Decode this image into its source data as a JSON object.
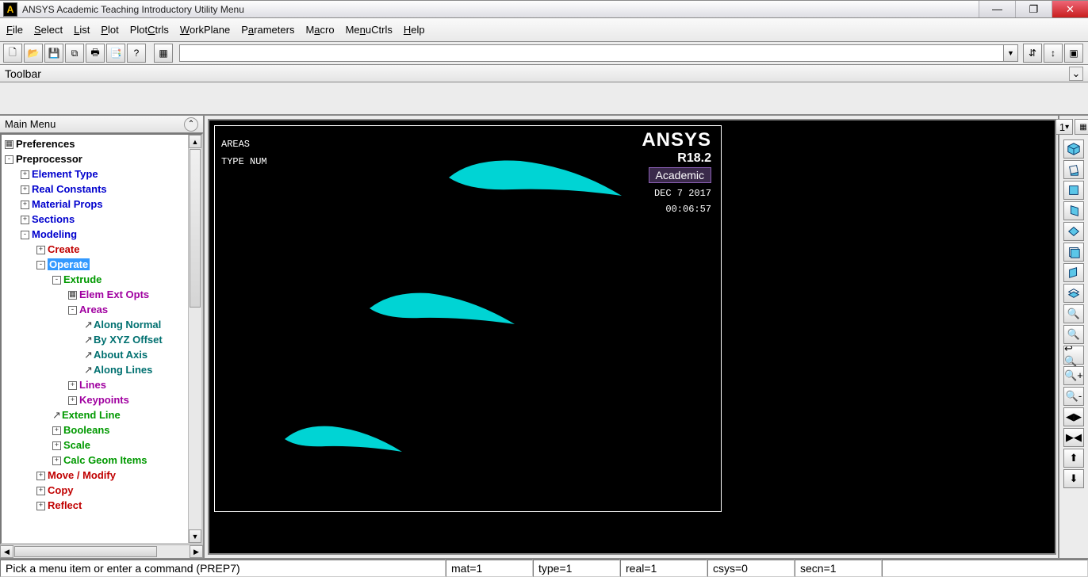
{
  "window": {
    "title": "ANSYS Academic Teaching Introductory Utility Menu"
  },
  "menubar": [
    "File",
    "Select",
    "List",
    "Plot",
    "PlotCtrls",
    "WorkPlane",
    "Parameters",
    "Macro",
    "MenuCtrls",
    "Help"
  ],
  "toolbar_label": "Toolbar",
  "mainmenu_label": "Main Menu",
  "command_input": "",
  "tree": {
    "preferences": "Preferences",
    "preprocessor": "Preprocessor",
    "element_type": "Element Type",
    "real_constants": "Real Constants",
    "material_props": "Material Props",
    "sections": "Sections",
    "modeling": "Modeling",
    "create": "Create",
    "operate": "Operate",
    "extrude": "Extrude",
    "elem_ext_opts": "Elem Ext Opts",
    "areas": "Areas",
    "along_normal": "Along Normal",
    "by_xyz_offset": "By XYZ Offset",
    "about_axis": "About Axis",
    "along_lines": "Along Lines",
    "lines": "Lines",
    "keypoints": "Keypoints",
    "extend_line": "Extend Line",
    "booleans": "Booleans",
    "scale": "Scale",
    "calc_geom_items": "Calc Geom Items",
    "move_modify": "Move / Modify",
    "copy": "Copy",
    "reflect": "Reflect"
  },
  "graphics": {
    "label1": "AREAS",
    "label2": "TYPE NUM",
    "brand": "ANSYS",
    "version": "R18.2",
    "edition": "Academic",
    "date": "DEC  7 2017",
    "time": "00:06:57"
  },
  "right_view_selector": "1",
  "status": {
    "main": "Pick a menu item or enter a command (PREP7)",
    "mat": "mat=1",
    "type": "type=1",
    "real": "real=1",
    "csys": "csys=0",
    "secn": "secn=1"
  }
}
